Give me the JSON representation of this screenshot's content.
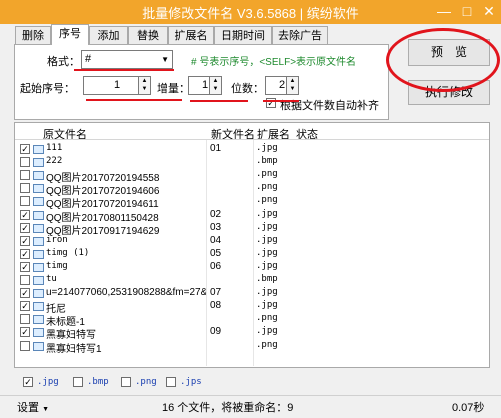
{
  "window": {
    "title": "批量修改文件名 V3.6.5868 | 缤纷软件",
    "minimize": "—",
    "maximize": "□",
    "close": "✕",
    "title_color": "#f2a52b"
  },
  "tabs": [
    {
      "label": "删除"
    },
    {
      "label": "序号"
    },
    {
      "label": "添加"
    },
    {
      "label": "替换"
    },
    {
      "label": "扩展名"
    },
    {
      "label": "日期时间"
    },
    {
      "label": "去除广告"
    }
  ],
  "sequence_panel": {
    "format_label": "格式：",
    "format_value": "#",
    "format_hint": "# 号表示序号，<SELF>表示原文件名",
    "start_label": "起始序号：",
    "start_value": "1",
    "increment_label": "增量：",
    "increment_value": "1",
    "digits_label": "位数：",
    "digits_value": "2",
    "auto_pad_label": "根据文件数自动补齐",
    "auto_pad_checked": true
  },
  "buttons": {
    "preview": "预　览",
    "execute": "执行修改"
  },
  "columns": {
    "original": "原文件名",
    "new": "新文件名",
    "ext": "扩展名",
    "status": "状态"
  },
  "files": [
    {
      "checked": true,
      "name": "111",
      "new": "01",
      "ext": ".jpg",
      "mono": true
    },
    {
      "checked": false,
      "name": "222",
      "new": "",
      "ext": ".bmp",
      "mono": true
    },
    {
      "checked": false,
      "name": "QQ图片20170720194558",
      "new": "",
      "ext": ".png",
      "mono": false
    },
    {
      "checked": false,
      "name": "QQ图片20170720194606",
      "new": "",
      "ext": ".png",
      "mono": false
    },
    {
      "checked": false,
      "name": "QQ图片20170720194611",
      "new": "",
      "ext": ".png",
      "mono": false
    },
    {
      "checked": true,
      "name": "QQ图片20170801150428",
      "new": "02",
      "ext": ".jpg",
      "mono": false
    },
    {
      "checked": true,
      "name": "QQ图片20170917194629",
      "new": "03",
      "ext": ".jpg",
      "mono": false
    },
    {
      "checked": true,
      "name": "iron",
      "new": "04",
      "ext": ".jpg",
      "mono": true
    },
    {
      "checked": true,
      "name": "timg (1)",
      "new": "05",
      "ext": ".jpg",
      "mono": true
    },
    {
      "checked": true,
      "name": "timg",
      "new": "06",
      "ext": ".jpg",
      "mono": true
    },
    {
      "checked": false,
      "name": "tu",
      "new": "",
      "ext": ".bmp",
      "mono": true
    },
    {
      "checked": true,
      "name": "u=214077060,2531908288&fm=27&gp=0",
      "new": "07",
      "ext": ".jpg",
      "mono": false
    },
    {
      "checked": true,
      "name": "托尼",
      "new": "08",
      "ext": ".jpg",
      "mono": false
    },
    {
      "checked": false,
      "name": "未标题-1",
      "new": "",
      "ext": ".png",
      "mono": false
    },
    {
      "checked": true,
      "name": "黑寡妇特写",
      "new": "09",
      "ext": ".jpg",
      "mono": false
    },
    {
      "checked": false,
      "name": "黑寡妇特写1",
      "new": "",
      "ext": ".png",
      "mono": false
    }
  ],
  "filters": [
    {
      "label": ".jpg",
      "checked": true
    },
    {
      "label": ".bmp",
      "checked": false
    },
    {
      "label": ".png",
      "checked": false
    },
    {
      "label": ".jps",
      "checked": false
    }
  ],
  "status_bar": {
    "settings": "设置",
    "settings_arrow": "▼",
    "summary": "16 个文件，将被重命名：9",
    "elapsed": "0.07秒"
  }
}
